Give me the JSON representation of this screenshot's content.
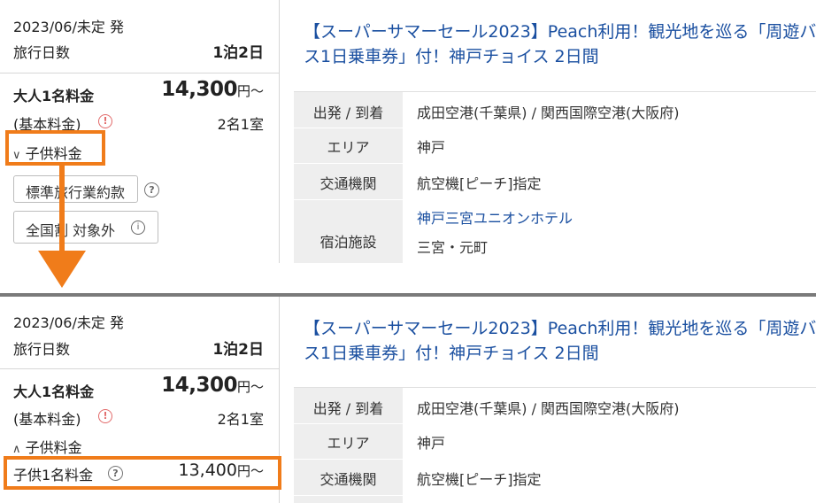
{
  "top": {
    "departure": "2023/06/未定 発",
    "duration_label": "旅行日数",
    "duration_value": "1泊2日",
    "adult_label": "大人1名料金",
    "adult_price": "14,300",
    "yen_suffix": "円～",
    "base_label": "(基本料金)",
    "warn_icon": "!",
    "rooms": "2名1室",
    "child_toggle": "子供料金",
    "child_toggle_icon": "∨",
    "terms_button": "標準旅行業約款",
    "q_icon": "?",
    "national_button": "全国割 対象外",
    "info_icon": "i",
    "title": "【スーパーサマーセール2023】Peach利用！観光地を巡る「周遊バス1日乗車券」付！神戸チョイス 2日間",
    "table": [
      {
        "label": "出発 / 到着",
        "value": "成田空港(千葉県) / 関西国際空港(大阪府)"
      },
      {
        "label": "エリア",
        "value": "神戸"
      },
      {
        "label": "交通機関",
        "value": "航空機[ピーチ]指定"
      },
      {
        "label": "宿泊施設",
        "value": "神戸三宮ユニオンホテル",
        "value2": "三宮・元町"
      }
    ]
  },
  "bottom": {
    "departure": "2023/06/未定 発",
    "duration_label": "旅行日数",
    "duration_value": "1泊2日",
    "adult_label": "大人1名料金",
    "adult_price": "14,300",
    "yen_suffix": "円～",
    "base_label": "(基本料金)",
    "warn_icon": "!",
    "rooms": "2名1室",
    "child_toggle": "子供料金",
    "child_toggle_icon": "∧",
    "child_label": "子供1名料金",
    "q_icon": "?",
    "child_price": "13,400",
    "title": "【スーパーサマーセール2023】Peach利用！観光地を巡る「周遊バス1日乗車券」付！神戸チョイス 2日間",
    "table": [
      {
        "label": "出発 / 到着",
        "value": "成田空港(千葉県) / 関西国際空港(大阪府)"
      },
      {
        "label": "エリア",
        "value": "神戸"
      },
      {
        "label": "交通機関",
        "value": "航空機[ピーチ]指定"
      }
    ]
  },
  "colors": {
    "accent": "#f07c1a",
    "link": "#1a4fa0",
    "warn": "#e26a6a",
    "table_header_bg": "#eeeeee"
  }
}
